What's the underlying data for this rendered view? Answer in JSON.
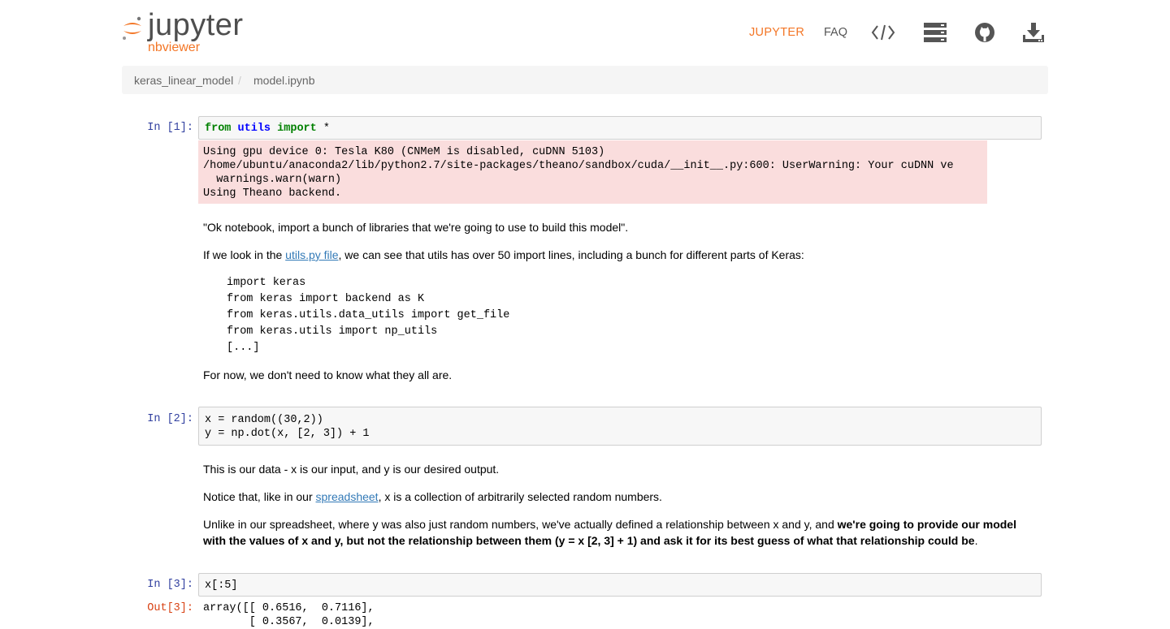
{
  "header": {
    "logo_word": "jupyter",
    "logo_sub": "nbviewer",
    "nav_jupyter": "JUPYTER",
    "nav_faq": "FAQ",
    "icons": [
      "code-icon",
      "server-icon",
      "github-icon",
      "download-icon"
    ]
  },
  "breadcrumb": {
    "items": [
      "keras_linear_model",
      "model.ipynb"
    ],
    "separator": "/"
  },
  "cells": {
    "c1": {
      "prompt": "In [1]:",
      "code_from": "from",
      "code_module": "utils",
      "code_import": "import",
      "code_star": "*",
      "stderr_lines": [
        "Using gpu device 0: Tesla K80 (CNMeM is disabled, cuDNN 5103)",
        "/home/ubuntu/anaconda2/lib/python2.7/site-packages/theano/sandbox/cuda/__init__.py:600: UserWarning: Your cuDNN ve",
        "  warnings.warn(warn)",
        "Using Theano backend."
      ]
    },
    "md1": {
      "p1": "\"Ok notebook, import a bunch of libraries that we're going to use to build this model\".",
      "p2_before": "If we look in the ",
      "p2_link": "utils.py file",
      "p2_after": ", we can see that utils has over 50 import lines, including a bunch for different parts of Keras:",
      "code_lines": [
        "import keras",
        "from keras import backend as K",
        "from keras.utils.data_utils import get_file",
        "from keras.utils import np_utils",
        "[...]"
      ],
      "p3": "For now, we don't need to know what they all are."
    },
    "c2": {
      "prompt": "In [2]:",
      "line1": "x = random((30,2))",
      "line2": "y = np.dot(x, [2, 3]) + 1"
    },
    "md2": {
      "p1": "This is our data - x is our input, and y is our desired output.",
      "p2_before": "Notice that, like in our ",
      "p2_link": "spreadsheet",
      "p2_after": ", x is a collection of arbitrarily selected random numbers.",
      "p3_before": "Unlike in our spreadsheet, where y was also just random numbers, we've actually defined a relationship between x and y, and ",
      "p3_bold": "we're going to provide our model with the values of x and y, but not the relationship between them (y = x [2, 3] + 1) and ask it for its best guess of what that relationship could be",
      "p3_after": "."
    },
    "c3": {
      "prompt": "In [3]:",
      "code": "x[:5]",
      "out_prompt": "Out[3]:",
      "out_lines": [
        "array([[ 0.6516,  0.7116],",
        "       [ 0.3567,  0.0139],"
      ]
    }
  }
}
